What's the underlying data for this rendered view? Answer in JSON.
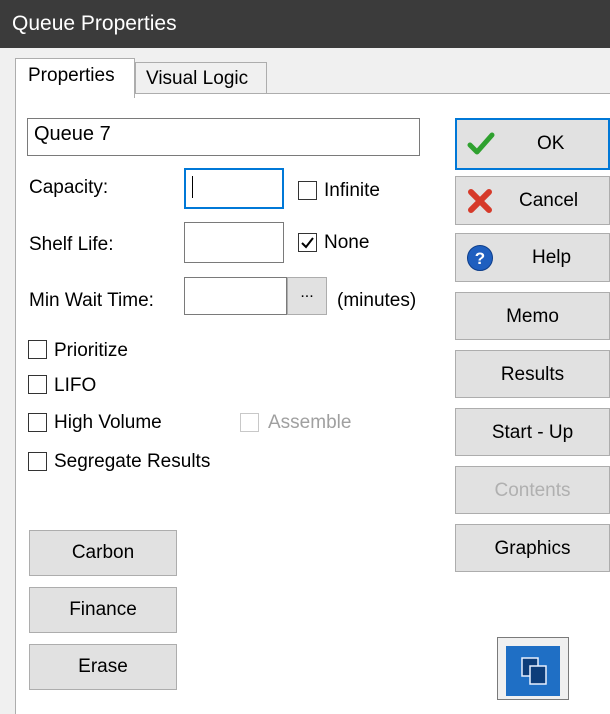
{
  "window": {
    "title": "Queue Properties"
  },
  "tabs": [
    {
      "label": "Properties"
    },
    {
      "label": "Visual Logic"
    }
  ],
  "name_field": {
    "value": "Queue 7"
  },
  "capacity": {
    "label": "Capacity:",
    "value": "",
    "infinite_label": "Infinite",
    "infinite_checked": false
  },
  "shelf_life": {
    "label": "Shelf Life:",
    "value": "",
    "none_label": "None",
    "none_checked": true
  },
  "min_wait": {
    "label": "Min Wait Time:",
    "value": "",
    "button_label": "...",
    "unit_label": "(minutes)"
  },
  "options": {
    "prioritize": "Prioritize",
    "lifo": "LIFO",
    "high_volume": "High Volume",
    "assemble": "Assemble",
    "segregate": "Segregate Results"
  },
  "left_buttons": {
    "carbon": "Carbon",
    "finance": "Finance",
    "erase": "Erase"
  },
  "right_buttons": {
    "ok": "OK",
    "cancel": "Cancel",
    "help": "Help",
    "memo": "Memo",
    "results": "Results",
    "startup": "Start - Up",
    "contents": "Contents",
    "graphics": "Graphics"
  },
  "icons": {
    "ok": "checkmark-icon",
    "cancel": "red-x-icon",
    "help": "question-icon",
    "copy": "copy-icon"
  },
  "colors": {
    "titlebar": "#3b3b3b",
    "focus": "#0078d7",
    "ok_green": "#2fa12f",
    "cancel_red": "#d63a2a",
    "help_blue": "#1f5fbf"
  }
}
